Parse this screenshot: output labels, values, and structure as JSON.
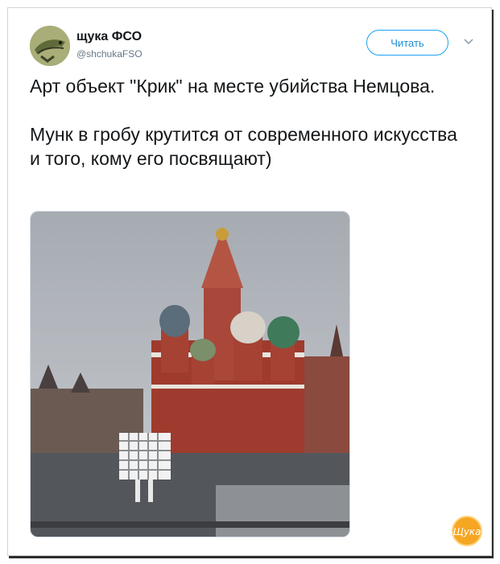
{
  "author": {
    "name": "щука ФСО",
    "handle": "@shchukaFSO"
  },
  "follow_button": {
    "label": "Читать"
  },
  "icons": {
    "avatar": "pike-fish-avatar",
    "menu": "chevron-down-icon",
    "watermark": "shchuka-logo-badge"
  },
  "tweet": {
    "paragraph_1": "Арт объект \"Крик\" на месте убийства Немцова.",
    "paragraph_2": "Мунк в гробу крутится от современного искусства и того, кому его посвящают)"
  },
  "watermark": {
    "text": "Щука"
  },
  "colors": {
    "accent": "#1da1f2",
    "text": "#14171a",
    "muted": "#657786",
    "badge": "#f5a623"
  }
}
